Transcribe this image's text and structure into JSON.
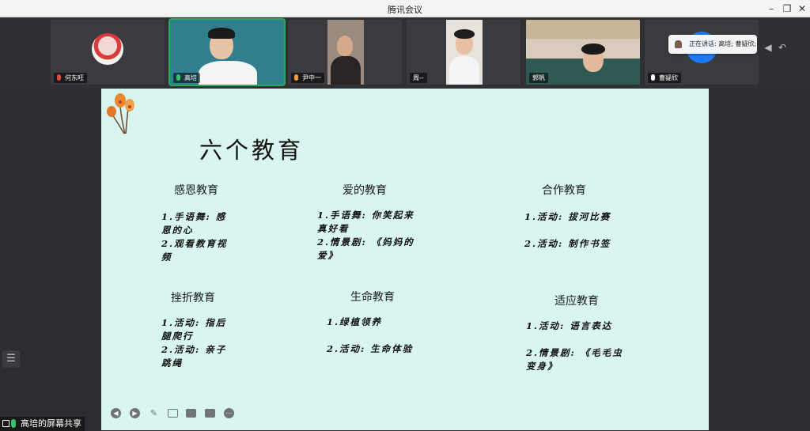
{
  "window": {
    "title": "腾讯会议"
  },
  "participants": [
    {
      "name": "何东旺",
      "mic": "muted"
    },
    {
      "name": "高培",
      "mic": "on"
    },
    {
      "name": "尹中一",
      "mic": "none"
    },
    {
      "name": "周--",
      "mic": "none"
    },
    {
      "name": "郭帆",
      "mic": "none"
    },
    {
      "name": "曹疑欣",
      "mic": "on"
    }
  ],
  "speaking": {
    "text": "正在讲话: 高培; 曹疑欣;"
  },
  "slide": {
    "title": "六个教育",
    "sections": [
      {
        "heading": "感恩教育",
        "items": [
          "1.手语舞: 感",
          "恩的心",
          "2.观看教育视",
          "频"
        ]
      },
      {
        "heading": "爱的教育",
        "items": [
          "1.手语舞: 你笑起来",
          "真好看",
          "2.情景剧: 《妈妈的",
          "爱》"
        ]
      },
      {
        "heading": "合作教育",
        "items": [
          "1.活动: 拔河比赛",
          "",
          "2.活动: 制作书签"
        ]
      },
      {
        "heading": "挫折教育",
        "items": [
          "1.活动: 指后",
          "腿爬行",
          "2.活动: 亲子",
          "跳绳"
        ]
      },
      {
        "heading": "生命教育",
        "items": [
          "1.绿植领养",
          "",
          "2.活动: 生命体验"
        ]
      },
      {
        "heading": "适应教育",
        "items": [
          "1.活动: 语言表达",
          "",
          "2.情景剧: 《毛毛虫",
          "变身》"
        ]
      }
    ]
  },
  "share_label": {
    "text": "高培的屏幕共享"
  },
  "colors": {
    "slide_bg": "#d9f5ef",
    "active_border": "#2eaa5b",
    "accent_blue": "#1f79f2"
  }
}
